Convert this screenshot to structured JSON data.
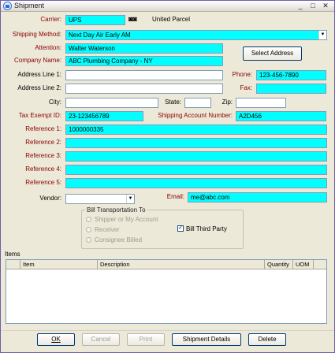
{
  "window": {
    "title": "Shipment",
    "controls": {
      "minimize": "_",
      "maximize": "□",
      "close": "✕"
    }
  },
  "form": {
    "carrier": {
      "label": "Carrier:",
      "value": "UPS",
      "name": "United Parcel"
    },
    "shipping_method": {
      "label": "Shipping Method:",
      "value": "Next Day Air Early AM"
    },
    "attention": {
      "label": "Attention:",
      "value": "Walter Waterson"
    },
    "company_name": {
      "label": "Company Name:",
      "value": "ABC Plumbing Company - NY"
    },
    "select_address_label": "Select Address",
    "address_line1": {
      "label": "Address Line 1:",
      "value": ""
    },
    "address_line2": {
      "label": "Address Line 2:",
      "value": ""
    },
    "phone": {
      "label": "Phone:",
      "value": "123-456-7890"
    },
    "fax": {
      "label": "Fax:",
      "value": ""
    },
    "city": {
      "label": "City:",
      "value": ""
    },
    "state": {
      "label": "State:",
      "value": ""
    },
    "zip": {
      "label": "Zip:",
      "value": ""
    },
    "tax_exempt_id": {
      "label": "Tax Exempt ID:",
      "value": "23-123456789"
    },
    "shipping_account_number": {
      "label": "Shipping Account Number:",
      "value": "A2D456"
    },
    "references": [
      {
        "label": "Reference 1:",
        "value": "1000000335"
      },
      {
        "label": "Reference 2:",
        "value": ""
      },
      {
        "label": "Reference 3:",
        "value": ""
      },
      {
        "label": "Reference 4:",
        "value": ""
      },
      {
        "label": "Reference 5:",
        "value": ""
      }
    ],
    "vendor": {
      "label": "Vendor:",
      "value": ""
    },
    "email": {
      "label": "Email:",
      "value": "me@abc.com"
    }
  },
  "bill_transportation": {
    "title": "Bill Transportation To",
    "options": [
      "Shipper or My Account",
      "Receiver",
      "Consignee Billed"
    ],
    "third_party_label": "Bill Third Party",
    "third_party_checked": "✓"
  },
  "items": {
    "label": "Items",
    "columns": [
      "",
      "Item",
      "Description",
      "Quantity",
      "UOM"
    ]
  },
  "buttons": {
    "ok": "OK",
    "cancel": "Cancel",
    "print": "Print",
    "shipment_details": "Shipment Details",
    "delete": "Delete"
  },
  "colors": {
    "field_bg": "#00ffff",
    "required_label": "#8b0000",
    "window_bg": "#ece9d8"
  }
}
